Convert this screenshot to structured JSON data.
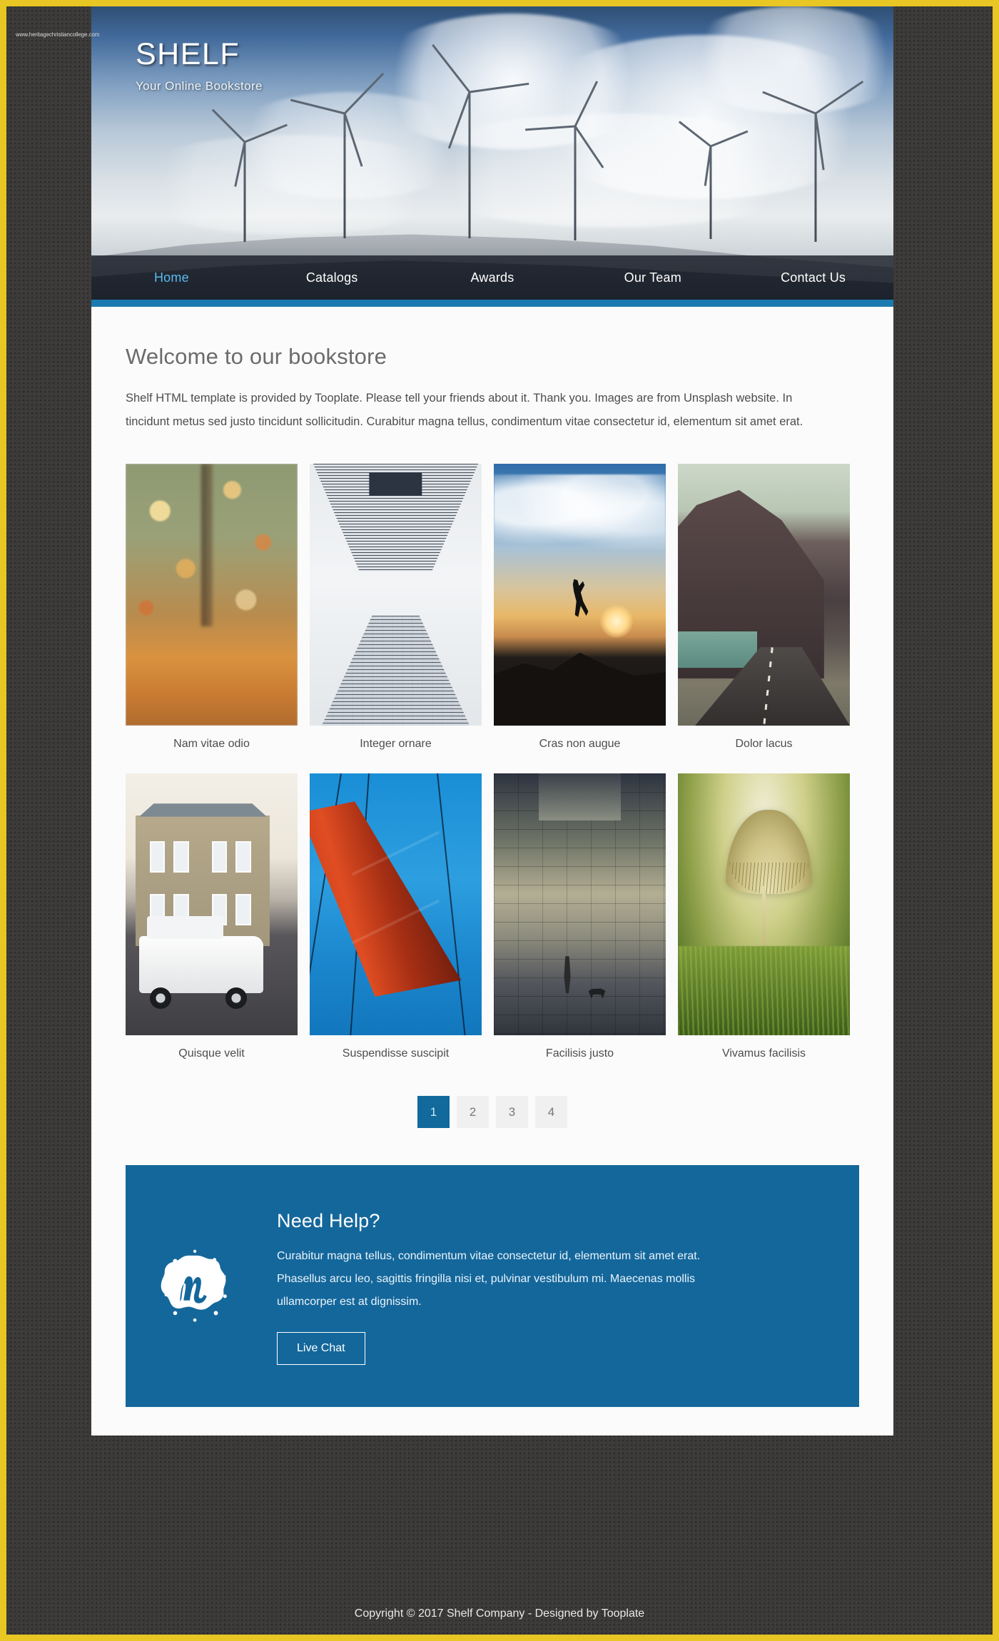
{
  "site": {
    "brand_name": "SHELF",
    "tagline": "Your Online Bookstore"
  },
  "nav": {
    "items": [
      {
        "label": "Home",
        "active": true
      },
      {
        "label": "Catalogs",
        "active": false
      },
      {
        "label": "Awards",
        "active": false
      },
      {
        "label": "Our Team",
        "active": false
      },
      {
        "label": "Contact Us",
        "active": false
      }
    ]
  },
  "welcome": {
    "title": "Welcome to our bookstore",
    "paragraph": "Shelf HTML template is provided by Tooplate. Please tell your friends about it. Thank you. Images are from Unsplash website. In tincidunt metus sed justo tincidunt sollicitudin. Curabitur magna tellus, condimentum vitae consectetur id, elementum sit amet erat."
  },
  "gallery": {
    "row1": [
      {
        "caption": "Nam vitae odio",
        "image": "autumn-forest-photo"
      },
      {
        "caption": "Integer ornare",
        "image": "skyscraper-photo"
      },
      {
        "caption": "Cras non augue",
        "image": "jumping-person-sunset-photo"
      },
      {
        "caption": "Dolor lacus",
        "image": "mountain-road-photo"
      }
    ],
    "row2": [
      {
        "caption": "Quisque velit",
        "image": "house-and-jeep-photo"
      },
      {
        "caption": "Suspendisse suscipit",
        "image": "red-bridge-photo"
      },
      {
        "caption": "Facilisis justo",
        "image": "girl-with-dog-wall-photo"
      },
      {
        "caption": "Vivamus facilisis",
        "image": "mushroom-macro-photo"
      }
    ]
  },
  "pagination": {
    "pages": [
      {
        "label": "1",
        "active": true
      },
      {
        "label": "2",
        "active": false
      },
      {
        "label": "3",
        "active": false
      },
      {
        "label": "4",
        "active": false
      }
    ]
  },
  "help": {
    "logo_icon": "meetup-m-logo-icon",
    "title": "Need Help?",
    "paragraph": "Curabitur magna tellus, condimentum vitae consectetur id, elementum sit amet erat. Phasellus arcu leo, sagittis fringilla nisi et, pulvinar vestibulum mi. Maecenas mollis ullamcorper est at dignissim.",
    "button_label": "Live Chat"
  },
  "footer": {
    "copyright": "Copyright © 2017 Shelf Company - Designed by Tooplate",
    "watermark": "www.heritagechristiancollege.com"
  },
  "colors": {
    "accent_blue": "#14679b",
    "nav_underline": "#1b7bb0",
    "active_nav_link": "#59b9ec",
    "frame_yellow": "#e8c623",
    "page_background": "#3b3a38",
    "content_background": "#fbfbfb"
  }
}
